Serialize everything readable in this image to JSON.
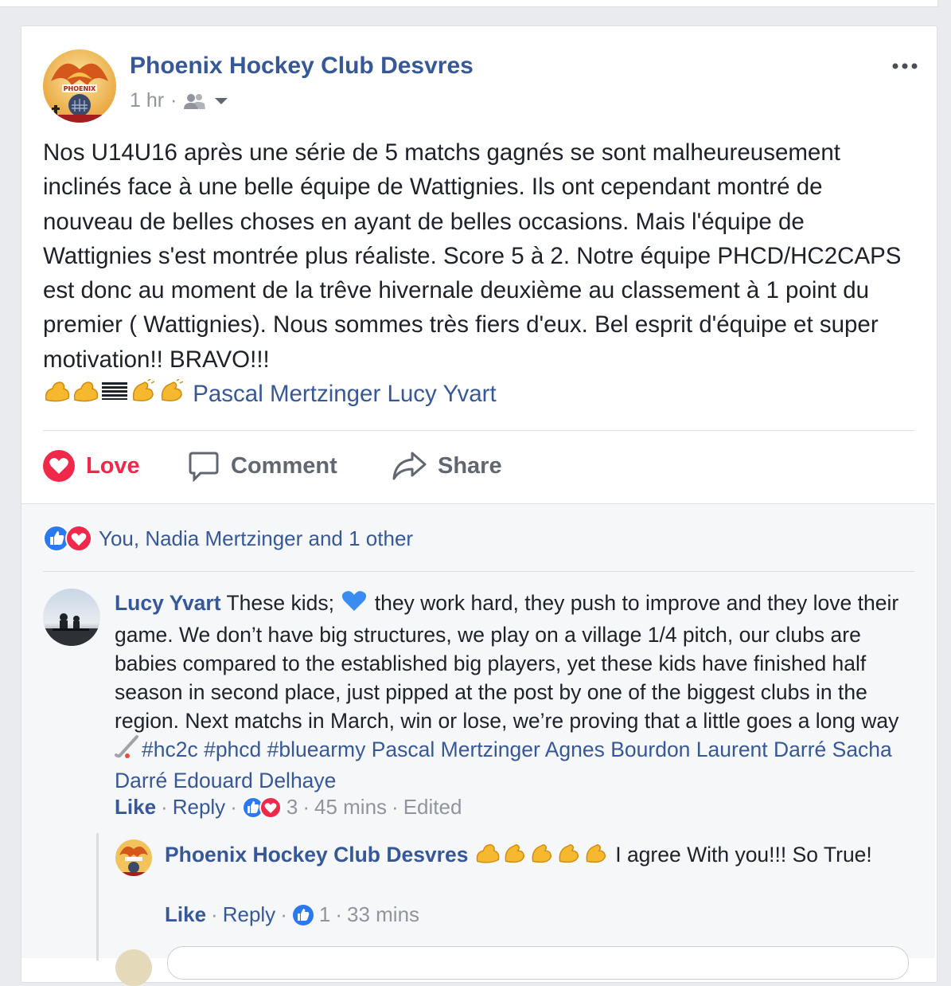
{
  "post": {
    "page_name": "Phoenix Hockey Club Desvres",
    "time": "1 hr",
    "separator": "·",
    "text": "Nos U14U16 après une série de 5 matchs gagnés se sont malheureusement inclinés face à une belle équipe de Wattignies. Ils ont cependant montré de nouveau de belles choses en ayant de belles occasions. Mais l'équipe de Wattignies s'est montrée plus réaliste. Score 5 à 2. Notre équipe PHCD/HC2CAPS est donc au moment de la trêve hivernale deuxième au classement à 1 point du premier ( Wattignies). Nous sommes très fiers d'eux. Bel esprit d'équipe et super motivation!! BRAVO!!!",
    "emojis": [
      "flexed-biceps",
      "flexed-biceps",
      "flag",
      "clapping-hands",
      "clapping-hands"
    ],
    "tags": "Pascal Mertzinger Lucy Yvart",
    "audience_icon": "friends-icon"
  },
  "actions": {
    "love": "Love",
    "comment": "Comment",
    "share": "Share"
  },
  "reactions": {
    "summary": "You, Nadia Mertzinger and 1 other",
    "icons": [
      "like-icon",
      "heart-icon"
    ]
  },
  "comments": [
    {
      "author": "Lucy Yvart",
      "text_part1": "These kids;",
      "text_part2": "they work hard, they push to improve and they love their game. We don’t have big structures, we play on a village 1/4 pitch, our clubs are babies compared to the established big players, yet these kids have finished half season in second place, just pipped at the post by one of the biggest clubs in the region. Next matchs in March, win or lose, we’re proving that a little goes a long way",
      "hashtags": "#hc2c #phcd #bluearmy",
      "tags": "Pascal Mertzinger Agnes Bourdon Laurent Darré Sacha Darré Edouard Delhaye",
      "like": "Like",
      "reply": "Reply",
      "reaction_count": "3",
      "time": "45 mins",
      "edited": "Edited",
      "dot": "·"
    }
  ],
  "replies": [
    {
      "author": "Phoenix Hockey Club Desvres",
      "text_after": "I agree With you!!! So True!",
      "like": "Like",
      "reply": "Reply",
      "reaction_count": "1",
      "time": "33 mins",
      "dot": "·"
    }
  ],
  "colors": {
    "link": "#365899",
    "love": "#f0284a",
    "text": "#1d2129",
    "meta": "#90949c"
  }
}
